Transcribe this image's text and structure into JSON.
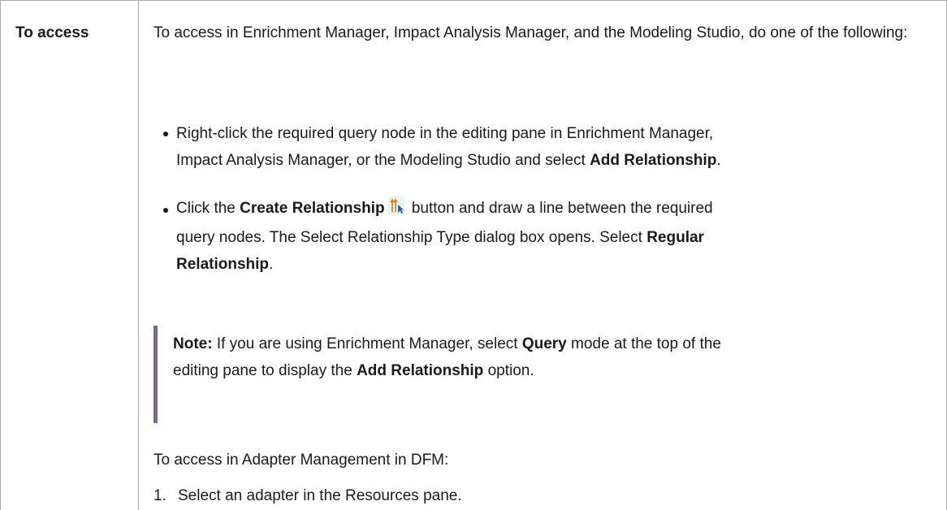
{
  "label": "To access",
  "intro": "To access in Enrichment Manager, Impact Analysis Manager, and the Modeling Studio, do one of the following:",
  "bullets": [
    {
      "line1": "Right-click the required query node in the editing pane in Enrichment Manager,",
      "line2_pre": "Impact Analysis Manager, or the Modeling Studio and select ",
      "line2_bold": "Add Relationship",
      "line2_post": "."
    },
    {
      "pre": "Click the ",
      "bold1": "Create Relationship",
      "icon": "create-relationship-icon",
      "mid": " button and draw a line between the required",
      "line2": "query nodes. The Select Relationship Type dialog box opens. Select ",
      "bold2a": "Regular",
      "bold2b": "Relationship",
      "post": "."
    }
  ],
  "note": {
    "label": "Note:",
    "l1_pre": " If you are using Enrichment Manager, select ",
    "l1_bold": "Query",
    "l1_post": " mode at the top of the",
    "l2_pre": "editing pane to display the ",
    "l2_bold": "Add Relationship",
    "l2_post": " option."
  },
  "dfm_intro": "To access in Adapter Management in DFM:",
  "steps": [
    {
      "num": "1.",
      "text": "Select an adapter in the Resources pane."
    }
  ]
}
